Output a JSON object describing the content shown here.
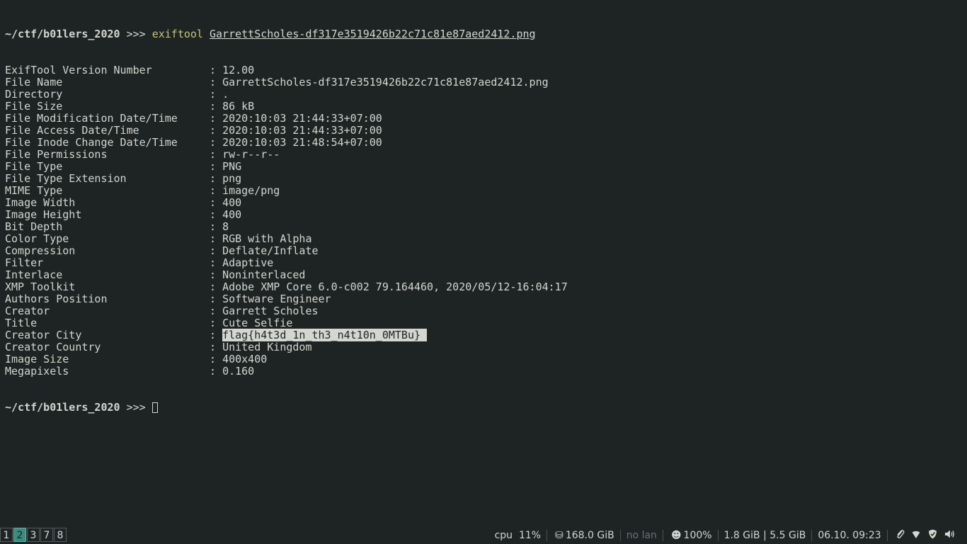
{
  "terminal": {
    "prompt_dir": "~/ctf/b01lers_2020",
    "prompt_arrows": ">>>",
    "command": "exiftool",
    "argument": "GarrettScholes-df317e3519426b22c71c81e87aed2412.png",
    "rows": [
      {
        "key": "ExifTool Version Number",
        "value": "12.00"
      },
      {
        "key": "File Name",
        "value": "GarrettScholes-df317e3519426b22c71c81e87aed2412.png"
      },
      {
        "key": "Directory",
        "value": "."
      },
      {
        "key": "File Size",
        "value": "86 kB"
      },
      {
        "key": "File Modification Date/Time",
        "value": "2020:10:03 21:44:33+07:00"
      },
      {
        "key": "File Access Date/Time",
        "value": "2020:10:03 21:44:33+07:00"
      },
      {
        "key": "File Inode Change Date/Time",
        "value": "2020:10:03 21:48:54+07:00"
      },
      {
        "key": "File Permissions",
        "value": "rw-r--r--"
      },
      {
        "key": "File Type",
        "value": "PNG"
      },
      {
        "key": "File Type Extension",
        "value": "png"
      },
      {
        "key": "MIME Type",
        "value": "image/png"
      },
      {
        "key": "Image Width",
        "value": "400"
      },
      {
        "key": "Image Height",
        "value": "400"
      },
      {
        "key": "Bit Depth",
        "value": "8"
      },
      {
        "key": "Color Type",
        "value": "RGB with Alpha"
      },
      {
        "key": "Compression",
        "value": "Deflate/Inflate"
      },
      {
        "key": "Filter",
        "value": "Adaptive"
      },
      {
        "key": "Interlace",
        "value": "Noninterlaced"
      },
      {
        "key": "XMP Toolkit",
        "value": "Adobe XMP Core 6.0-c002 79.164460, 2020/05/12-16:04:17"
      },
      {
        "key": "Authors Position",
        "value": "Software Engineer"
      },
      {
        "key": "Creator",
        "value": "Garrett Scholes"
      },
      {
        "key": "Title",
        "value": "Cute Selfie"
      },
      {
        "key": "Creator City",
        "value": "flag{h4t3d_1n_th3_n4t10n_0MTBu} ",
        "highlighted": true
      },
      {
        "key": "Creator Country",
        "value": "United Kingdom"
      },
      {
        "key": "Image Size",
        "value": "400x400"
      },
      {
        "key": "Megapixels",
        "value": "0.160"
      }
    ]
  },
  "bar": {
    "workspaces": [
      {
        "label": "1",
        "active": false
      },
      {
        "label": "2",
        "active": true
      },
      {
        "label": "3",
        "active": false
      },
      {
        "label": "7",
        "active": false
      },
      {
        "label": "8",
        "active": false
      }
    ],
    "cpu_label": "cpu",
    "cpu_value": "11%",
    "disk_icon": "disk-icon",
    "disk_value": "168.0 GiB",
    "lan_value": "no lan",
    "battery_icon": "smiley-icon",
    "battery_value": "100%",
    "mem_value": "1.8 GiB | 5.5 GiB",
    "datetime": "06.10. 09:23",
    "tray_icons": [
      "paperclip-icon",
      "wifi-icon",
      "shield-icon",
      "volume-icon"
    ],
    "accent_color": "#3c8a80"
  }
}
